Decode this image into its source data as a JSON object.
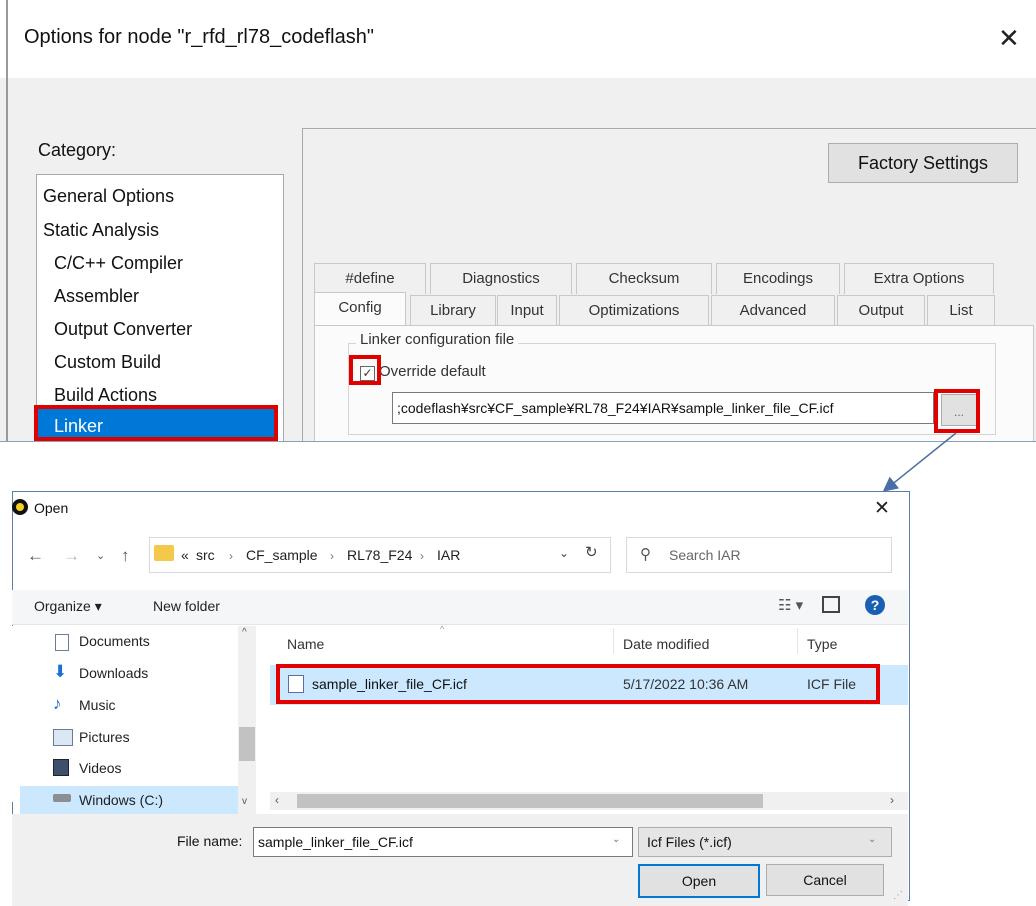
{
  "options_dialog": {
    "title": "Options for node \"r_rfd_rl78_codeflash\"",
    "close_glyph": "✕",
    "category_label": "Category:",
    "categories": [
      {
        "label": "General Options",
        "indent": 0
      },
      {
        "label": "Static Analysis",
        "indent": 0
      },
      {
        "label": "C/C++ Compiler",
        "indent": 1
      },
      {
        "label": "Assembler",
        "indent": 1
      },
      {
        "label": "Output Converter",
        "indent": 1
      },
      {
        "label": "Custom Build",
        "indent": 1
      },
      {
        "label": "Build Actions",
        "indent": 1
      },
      {
        "label": "Linker",
        "indent": 1,
        "selected": true
      }
    ],
    "factory_settings_label": "Factory Settings",
    "tabs_row1": [
      "#define",
      "Diagnostics",
      "Checksum",
      "Encodings",
      "Extra Options"
    ],
    "tabs_row2": [
      "Config",
      "Library",
      "Input",
      "Optimizations",
      "Advanced",
      "Output",
      "List"
    ],
    "active_tab": "Config",
    "group_label": "Linker configuration file",
    "override_label": "Override default",
    "override_checked": true,
    "path_value": ";codeflash¥src¥CF_sample¥RL78_F24¥IAR¥sample_linker_file_CF.icf",
    "browse_label": "..."
  },
  "open_dialog": {
    "title": "Open",
    "close_glyph": "✕",
    "breadcrumb": [
      "«",
      "src",
      "CF_sample",
      "RL78_F24",
      "IAR"
    ],
    "search_placeholder": "Search IAR",
    "organize_label": "Organize ▾",
    "new_folder_label": "New folder",
    "nav_items": [
      {
        "label": "Documents",
        "icon": "documents-icon"
      },
      {
        "label": "Downloads",
        "icon": "downloads-icon"
      },
      {
        "label": "Music",
        "icon": "music-icon"
      },
      {
        "label": "Pictures",
        "icon": "pictures-icon"
      },
      {
        "label": "Videos",
        "icon": "videos-icon"
      },
      {
        "label": "Windows (C:)",
        "icon": "drive-icon",
        "selected": true
      }
    ],
    "columns": [
      "Name",
      "Date modified",
      "Type"
    ],
    "files": [
      {
        "name": "sample_linker_file_CF.icf",
        "date": "5/17/2022 10:36 AM",
        "type": "ICF File",
        "selected": true
      }
    ],
    "file_name_label": "File name:",
    "file_name_value": "sample_linker_file_CF.icf",
    "filter_value": "Icf Files (*.icf)",
    "open_label": "Open",
    "cancel_label": "Cancel"
  },
  "colors": {
    "highlight_red": "#e00000",
    "selection_blue": "#0078d7",
    "row_selection": "#cce8ff"
  }
}
